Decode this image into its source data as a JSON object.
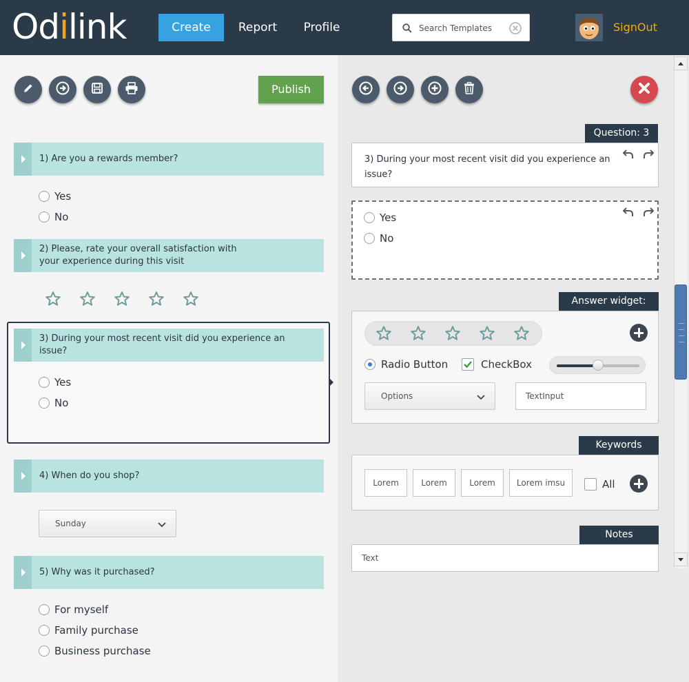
{
  "header": {
    "logo_text_1": "Od",
    "logo_text_i": "i",
    "logo_text_2": "link",
    "nav": [
      {
        "label": "Create",
        "active": true
      },
      {
        "label": "Report",
        "active": false
      },
      {
        "label": "Profile",
        "active": false
      }
    ],
    "search_placeholder": "Search Templates",
    "signout_label": "SignOut",
    "accent": "#f0a81c",
    "active_nav_color": "#36a2e0"
  },
  "left_toolbar": {
    "icons": [
      "pencil-icon",
      "arrow-right-circle-icon",
      "save-icon",
      "print-icon"
    ],
    "publish_label": "Publish"
  },
  "questions": [
    {
      "number": 1,
      "text": "1) Are you  a rewards member?",
      "type": "radio",
      "options": [
        "Yes",
        "No"
      ]
    },
    {
      "number": 2,
      "text": "2) Please, rate your overall satisfaction with your experience during this visit",
      "type": "rating",
      "stars": 5
    },
    {
      "number": 3,
      "text": "3) During your most recent visit did you experience an issue?",
      "type": "radio",
      "options": [
        "Yes",
        "No"
      ],
      "selected": true
    },
    {
      "number": 4,
      "text": "4) When do you shop?",
      "type": "select",
      "value": "Sunday"
    },
    {
      "number": 5,
      "text": "5) Why was it purchased?",
      "type": "radio",
      "options": [
        "For myself",
        "Family purchase",
        "Business purchase"
      ]
    }
  ],
  "editor": {
    "toolbar_icons": [
      "arrow-left-circle-icon",
      "arrow-right-circle-icon",
      "plus-circle-icon",
      "trash-icon"
    ],
    "question_tab": "Question: 3",
    "question_text": "3) During your most recent visit did you experience an issue?",
    "answer_options": [
      "Yes",
      "No"
    ],
    "answer_widget_tab": "Answer widget:",
    "widgets": {
      "stars": 5,
      "radio_label": "Radio Button",
      "checkbox_label": "CheckBox",
      "slider_level": 0.5,
      "options_label": "Options",
      "text_input_placeholder": "TextInput"
    },
    "keywords_tab": "Keywords",
    "keywords": [
      "Lorem",
      "Lorem",
      "Lorem",
      "Lorem imsu"
    ],
    "all_label": "All",
    "notes_tab": "Notes",
    "notes_placeholder": "Text"
  }
}
